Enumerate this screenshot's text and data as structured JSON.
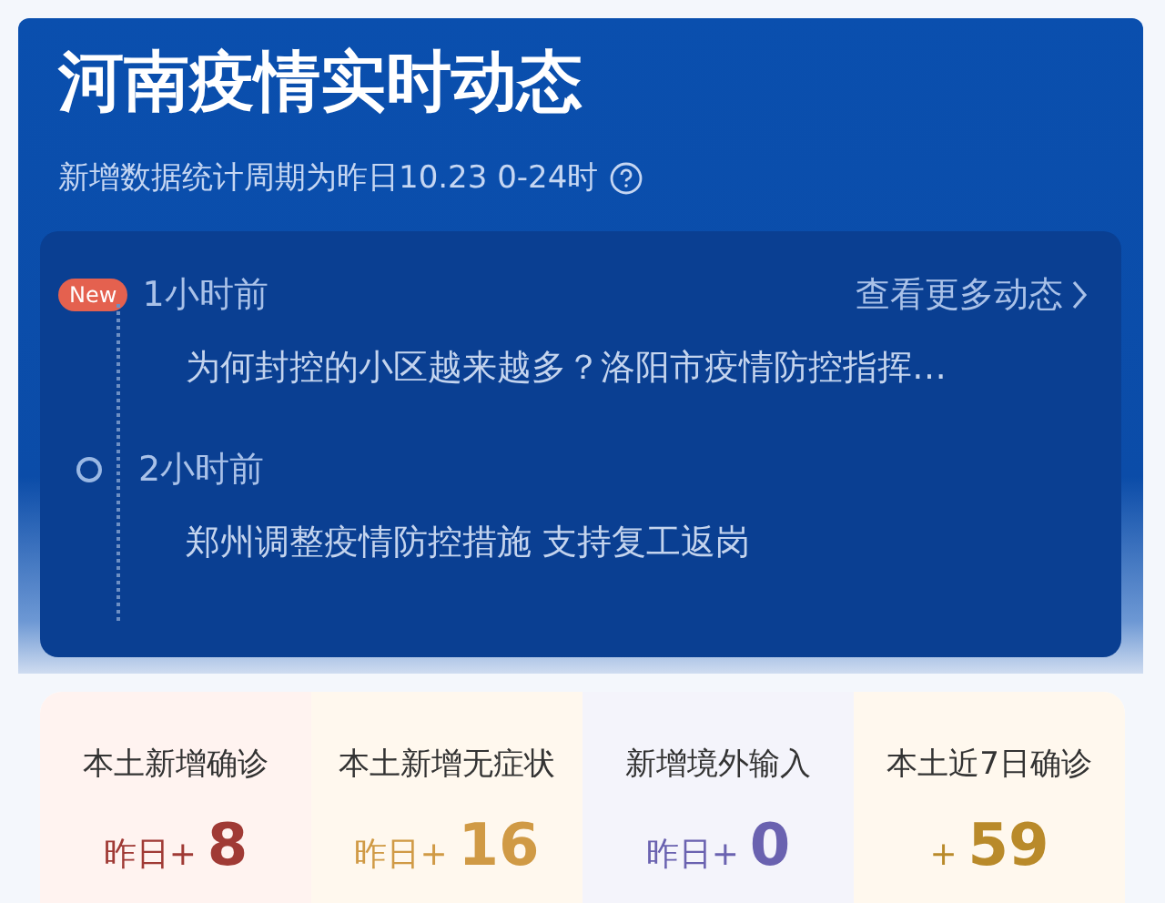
{
  "header": {
    "title": "河南疫情实时动态",
    "subtitle": "新增数据统计周期为昨日10.23 0-24时"
  },
  "news": {
    "more_link": "查看更多动态",
    "items": [
      {
        "badge": "New",
        "time": "1小时前",
        "headline": "为何封控的小区越来越多？洛阳市疫情防控指挥…"
      },
      {
        "time": "2小时前",
        "headline": "郑州调整疫情防控措施 支持复工返岗"
      }
    ]
  },
  "stats": [
    {
      "label": "本土新增确诊",
      "prefix": "昨日+",
      "value": "8",
      "color": "#a03a35"
    },
    {
      "label": "本土新增无症状",
      "prefix": "昨日+",
      "value": "16",
      "color": "#d09a45"
    },
    {
      "label": "新增境外输入",
      "prefix": "昨日+",
      "value": "0",
      "color": "#6a62b0"
    },
    {
      "label": "本土近7日确诊",
      "prefix": "+",
      "value": "59",
      "color": "#b98a2a"
    }
  ]
}
